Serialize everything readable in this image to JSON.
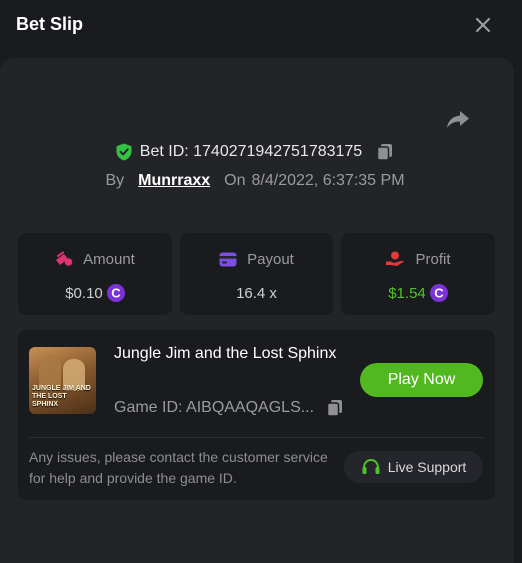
{
  "header": {
    "title": "Bet Slip"
  },
  "bet": {
    "id_label": "Bet ID: 1740271942751783175",
    "by_label": "By",
    "username": "Munrraxx",
    "on_label": "On",
    "datetime": "8/4/2022, 6:37:35 PM"
  },
  "stats": {
    "amount": {
      "label": "Amount",
      "value": "$0.10",
      "icon": "coins-stack-icon",
      "icon_color": "#e0336e"
    },
    "payout": {
      "label": "Payout",
      "value": "16.4 x",
      "icon": "card-icon",
      "icon_color": "#7b4ee6"
    },
    "profit": {
      "label": "Profit",
      "value": "$1.54",
      "icon": "hand-coin-icon",
      "icon_color": "#e23a3a",
      "value_color": "#4fc42a"
    }
  },
  "currency": {
    "icon": "currency-coin-icon",
    "color": "#7b32d6"
  },
  "game": {
    "name": "Jungle Jim and the Lost Sphinx",
    "thumb_text": "JUNGLE JIM AND THE LOST SPHINX",
    "id_label": "Game ID: AIBQAAQAGLS...",
    "play_label": "Play Now"
  },
  "support": {
    "message": "Any issues, please contact the customer service for help and provide the game ID.",
    "button_label": "Live Support"
  },
  "colors": {
    "accent_green": "#52b820",
    "shield_green": "#33c243",
    "background": "#1a1b1f",
    "panel": "#232428"
  }
}
